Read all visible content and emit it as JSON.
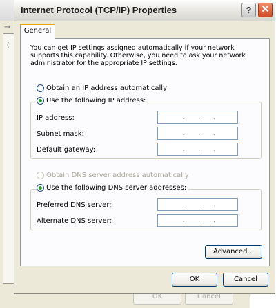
{
  "window": {
    "title": "Internet Protocol (TCP/IP) Properties",
    "help_glyph": "?",
    "close_glyph": "✕"
  },
  "background_window": {
    "tab_letter": "(",
    "ok_label": "OK",
    "cancel_label": "Cancel"
  },
  "tabs": [
    {
      "label": "General",
      "selected": true
    }
  ],
  "intro_text": "You can get IP settings assigned automatically if your network supports this capability. Otherwise, you need to ask your network administrator for the appropriate IP settings.",
  "ip_section": {
    "auto_label": "Obtain an IP address automatically",
    "auto_selected": false,
    "manual_label": "Use the following IP address:",
    "manual_selected": true,
    "fields": [
      {
        "label": "IP address:",
        "value": ". . ."
      },
      {
        "label": "Subnet mask:",
        "value": ". . ."
      },
      {
        "label": "Default gateway:",
        "value": ". . ."
      }
    ]
  },
  "dns_section": {
    "auto_label": "Obtain DNS server address automatically",
    "auto_disabled": true,
    "manual_label": "Use the following DNS server addresses:",
    "manual_selected": true,
    "fields": [
      {
        "label": "Preferred DNS server:",
        "value": ". . ."
      },
      {
        "label": "Alternate DNS server:",
        "value": ". . ."
      }
    ]
  },
  "buttons": {
    "advanced": "Advanced...",
    "ok": "OK",
    "cancel": "Cancel"
  },
  "colors": {
    "dialog_bg": "#ece9d8",
    "panel_bg": "#fcfcfe",
    "tab_accent": "#f0a20a",
    "radio_dot": "#21a121",
    "close_button": "#d04a26",
    "input_border": "#7f9db9"
  }
}
